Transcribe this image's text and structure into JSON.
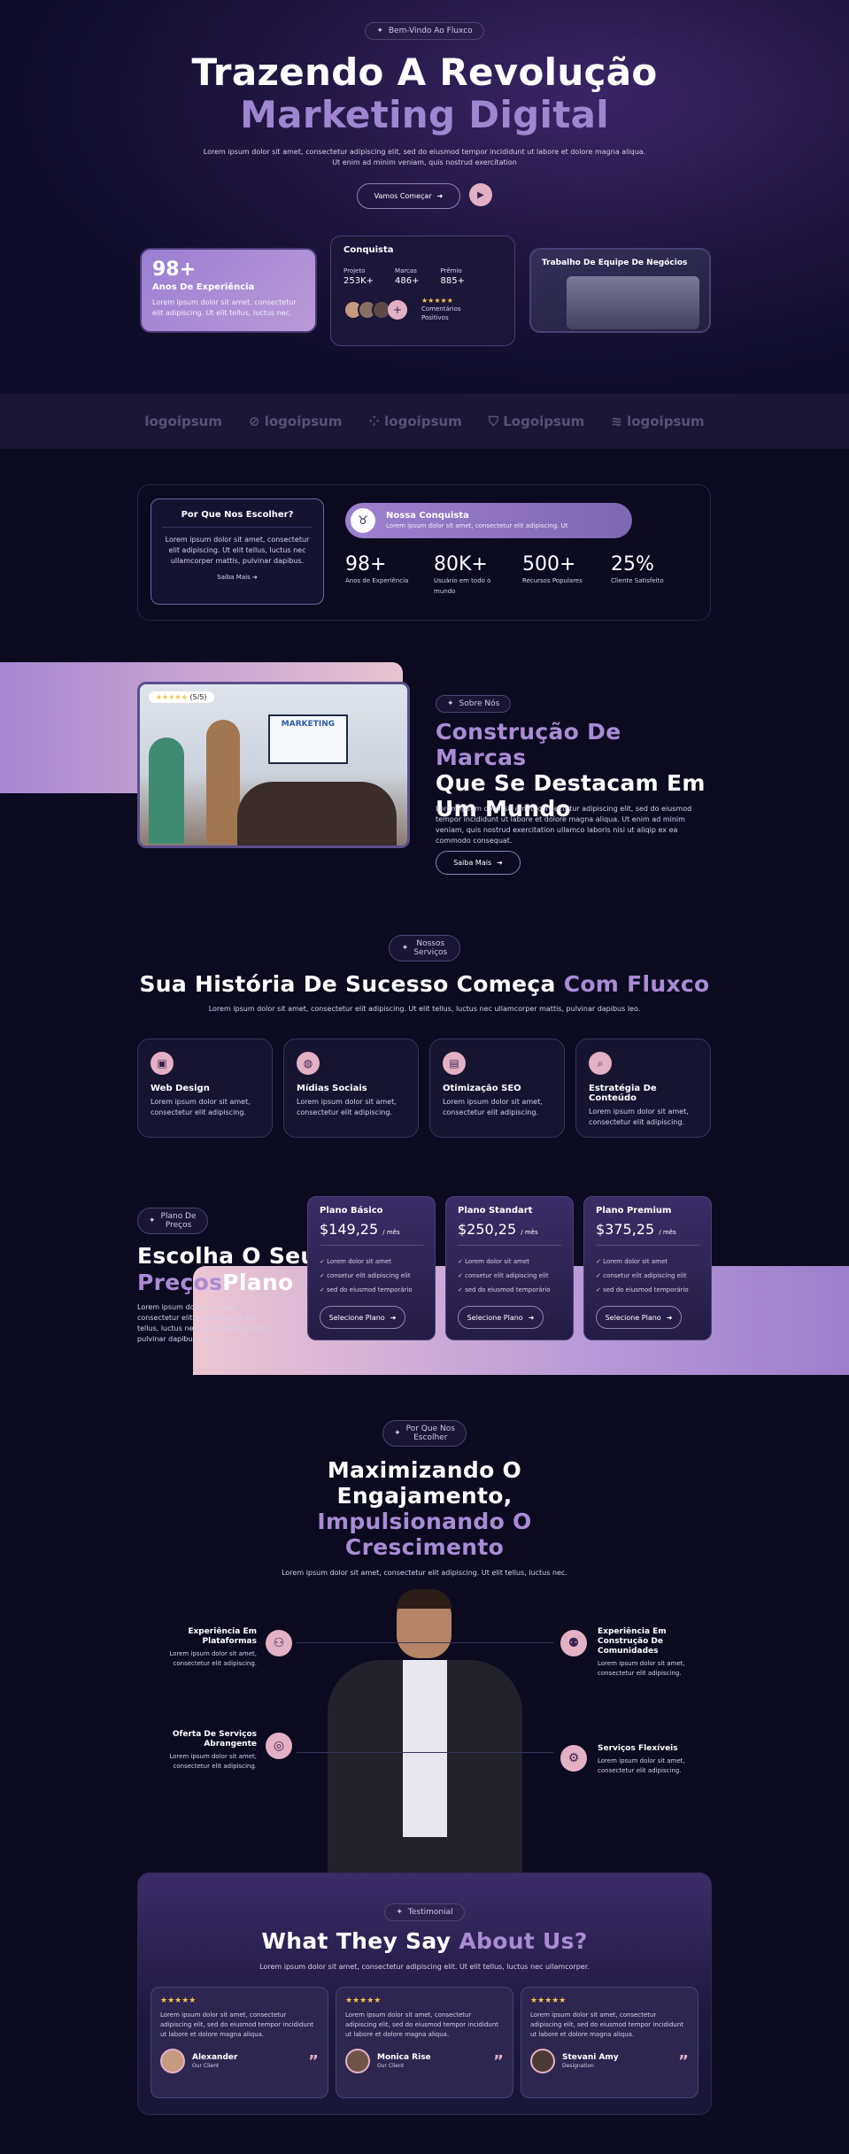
{
  "hero": {
    "badge": "Bem-Vindo Ao Fluxco",
    "title_line1": "Trazendo A Revolução",
    "title_line2": "Marketing Digital",
    "desc_line1": "Lorem ipsum dolor sit amet, consectetur adipiscing elit, sed do eiusmod tempor incididunt ut labore et dolore magna aliqua.",
    "desc_line2": "Ut enim ad minim veniam, quis nostrud exercitation",
    "cta_label": "Vamos Começar",
    "experience": {
      "number": "98+",
      "label": "Anos De Experiência",
      "text": "Lorem ipsum dolor sit amet, consectetur elit adipiscing. Ut elit tellus, luctus nec."
    },
    "conquista": {
      "title": "Conquista",
      "stats": [
        {
          "label": "Projeto",
          "value": "253K+"
        },
        {
          "label": "Marcas",
          "value": "486+"
        },
        {
          "label": "Prêmio",
          "value": "885+"
        }
      ],
      "stars": "★★★★★",
      "reviews_label_1": "Comentários",
      "reviews_label_2": "Positivos"
    },
    "team_card_title": "Trabalho De Equipe De Negócios"
  },
  "logos": [
    "logoipsum",
    "logoipsum",
    "logoipsum",
    "Logoipsum",
    "logoipsum"
  ],
  "why": {
    "title": "Por Que Nos Escolher?",
    "text": "Lorem ipsum dolor sit amet, consectetur elit adipiscing. Ut elit tellus, luctus nec ullamcorper mattis, pulvinar dapibus.",
    "link": "Saiba Mais",
    "achievement_title": "Nossa Conquista",
    "achievement_text": "Lorem ipsum dolor sit amet, consectetur elit adipiscing. Ut",
    "stats": [
      {
        "value": "98+",
        "label": "Anos de Experiência"
      },
      {
        "value": "80K+",
        "label": "Usuário em todo o mundo"
      },
      {
        "value": "500+",
        "label": "Recursos Populares"
      },
      {
        "value": "25%",
        "label": "Cliente Satisfeito"
      }
    ]
  },
  "about": {
    "badge": "Sobre Nós",
    "rating": "(5/5)",
    "stars": "★★★★★",
    "board_text": "MARKETING",
    "title_1": "Construção De Marcas",
    "title_2": "Que Se Destacam Em",
    "title_3": "Um Mundo",
    "text": "Lorem ipsum dolor sit amet, consectetur adipiscing elit, sed do eiusmod tempor incididunt ut labore et dolore magna aliqua. Ut enim ad minim veniam, quis nostrud exercitation ullamco laboris nisi ut aliqip ex ea commodo consequat.",
    "btn": "Saiba Mais"
  },
  "services": {
    "badge_1": "Nossos",
    "badge_2": "Serviços",
    "title_a": "Sua História De Sucesso Começa",
    "title_b": "Com Fluxco",
    "desc": "Lorem ipsum dolor sit amet, consectetur elit adipiscing. Ut elit tellus, luctus nec ullamcorper mattis, pulvinar dapibus leo.",
    "items": [
      {
        "title": "Web Design",
        "text": "Lorem ipsum dolor sit amet, consectetur elit adipiscing."
      },
      {
        "title": "Mídias Sociais",
        "text": "Lorem ipsum dolor sit amet, consectetur elit adipiscing."
      },
      {
        "title": "Otimização SEO",
        "text": "Lorem ipsum dolor sit amet, consectetur elit adipiscing."
      },
      {
        "title": "Estratégia De Conteúdo",
        "text": "Lorem ipsum dolor sit amet, consectetur elit adipiscing."
      }
    ]
  },
  "pricing": {
    "badge_1": "Plano De",
    "badge_2": "Preços",
    "title_1": "Escolha O Seu",
    "title_2": "Preços",
    "title_3": "Plano",
    "desc": "Lorem ipsum dolor sit amet, consectetur elit adipiscing. Ut elit tellus, luctus nec ullamcorper mattis, pulvinar dapibus leo.",
    "plans": [
      {
        "name": "Plano Básico",
        "price": "$149,25",
        "period": "/ mês",
        "features": [
          "Lorem dolor sit amet",
          "consetur elit adipiscing elit",
          "sed do eiusmod temporário"
        ],
        "btn": "Selecione Plano"
      },
      {
        "name": "Plano Standart",
        "price": "$250,25",
        "period": "/ mês",
        "features": [
          "Lorem dolor sit amet",
          "consetur elit adipiscing elit",
          "sed do eiusmod temporário"
        ],
        "btn": "Selecione Plano"
      },
      {
        "name": "Plano Premium",
        "price": "$375,25",
        "period": "/ mês",
        "features": [
          "Lorem dolor sit amet",
          "consetur elit adipiscing elit",
          "sed do eiusmod temporário"
        ],
        "btn": "Selecione Plano"
      }
    ]
  },
  "engage": {
    "badge_1": "Por Que Nos",
    "badge_2": "Escolher",
    "title_1": "Maximizando O",
    "title_2": "Engajamento,",
    "title_3": "Impulsionando O",
    "title_4": "Crescimento",
    "desc": "Lorem ipsum dolor sit amet, consectetur elit adipiscing. Ut elit tellus, luctus nec.",
    "features": [
      {
        "title_1": "Experiência Em",
        "title_2": "Plataformas",
        "text_1": "Lorem ipsum dolor sit amet,",
        "text_2": "consectetur elit adipiscing."
      },
      {
        "title_1": "Oferta De Serviços",
        "title_2": "Abrangente",
        "text_1": "Lorem ipsum dolor sit amet,",
        "text_2": "consectetur elit adipiscing."
      },
      {
        "title_1": "Experiência Em",
        "title_2": "Construção De",
        "title_3": "Comunidades",
        "text_1": "Lorem ipsum dolor sit amet,",
        "text_2": "consectetur elit adipiscing."
      },
      {
        "title_1": "Serviços Flexíveis",
        "text_1": "Lorem ipsum dolor sit amet,",
        "text_2": "consectetur elit adipiscing."
      }
    ]
  },
  "testimonials": {
    "badge": "Testimonial",
    "title_a": "What They Say",
    "title_b": "About Us?",
    "desc": "Lorem ipsum dolor sit amet, consectetur adipiscing elit. Ut elit tellus, luctus nec ullamcorper.",
    "items": [
      {
        "stars": "★★★★★",
        "text": "Lorem ipsum dolor sit amet, consectetur adipiscing elit, sed do eiusmod tempor incididunt ut labore et dolore magna aliqua.",
        "name": "Alexander",
        "role": "Our Client"
      },
      {
        "stars": "★★★★★",
        "text": "Lorem ipsum dolor sit amet, consectetur adipiscing elit, sed do eiusmod tempor incididunt ut labore et dolore magna aliqua.",
        "name": "Monica Rise",
        "role": "Our Client"
      },
      {
        "stars": "★★★★★",
        "text": "Lorem ipsum dolor sit amet, consectetur adipiscing elit, sed do eiusmod tempor incididunt ut labore et dolore magna aliqua.",
        "name": "Stevani Amy",
        "role": "Designation"
      }
    ]
  },
  "colors": {
    "bg": "#0b0a1f",
    "accent": "#a98bd6",
    "pink": "#e8b4c4"
  }
}
